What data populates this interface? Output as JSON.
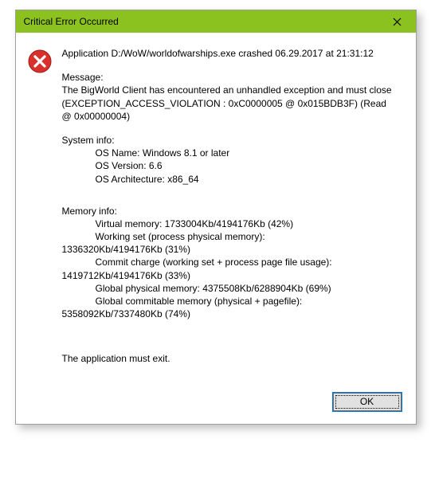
{
  "window": {
    "title": "Critical Error Occurred"
  },
  "icon": "error-icon",
  "headline": "Application D:/WoW/worldofwarships.exe crashed 06.29.2017 at 21:31:12",
  "message_head": "Message:",
  "message_body": "The BigWorld Client has encountered an unhandled exception and must close (EXCEPTION_ACCESS_VIOLATION : 0xC0000005 @ 0x015BDB3F) (Read @ 0x00000004)",
  "system_info_head": "System info:",
  "system_info": {
    "os_name": "OS Name: Windows 8.1 or later",
    "os_version": "OS Version: 6.6",
    "os_arch": "OS Architecture: x86_64"
  },
  "memory_info_head": "Memory info:",
  "memory_info": {
    "virtual": "Virtual memory: 1733004Kb/4194176Kb (42%)",
    "working_set_label": "Working set (process physical memory):",
    "working_set_value": "1336320Kb/4194176Kb (31%)",
    "commit_label": "Commit charge (working set + process page file usage):",
    "commit_value": "1419712Kb/4194176Kb (33%)",
    "global_physical": "Global physical memory: 4375508Kb/6288904Kb (69%)",
    "global_commit_label": "Global commitable memory (physical + pagefile):",
    "global_commit_value": "5358092Kb/7337480Kb (74%)"
  },
  "exit_line": "The application must exit.",
  "buttons": {
    "ok": "OK"
  }
}
